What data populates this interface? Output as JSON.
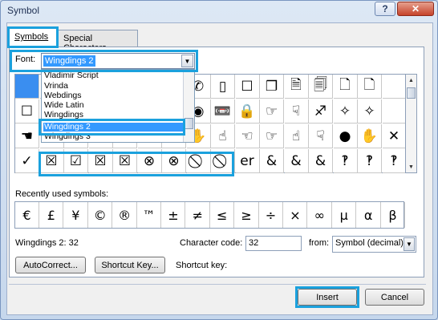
{
  "window": {
    "title": "Symbol",
    "help": "?",
    "close": "✕"
  },
  "tabs": [
    {
      "label": "Symbols",
      "active": true
    },
    {
      "label": "Special Characters",
      "active": false
    }
  ],
  "font": {
    "label": "Font:",
    "value": "Wingdings 2"
  },
  "font_dropdown": {
    "options": [
      "Vladimir Script",
      "Vrinda",
      "Webdings",
      "Wide Latin",
      "Wingdings",
      "Wingdings 2",
      "Wingdings 3"
    ],
    "selected": "Wingdings 2"
  },
  "grid": {
    "rows": [
      [
        "",
        "",
        "",
        "",
        "",
        "",
        "",
        "✆",
        "▯",
        "☐",
        "❐",
        "🗎",
        "🗐",
        "🗋",
        "🗋",
        ""
      ],
      [
        "☐",
        "",
        "",
        "",
        "",
        "",
        "",
        "◉",
        "📼",
        "🔒",
        "☞",
        "☟",
        "♐",
        "✧",
        "✧",
        ""
      ],
      [
        "☚",
        "",
        "",
        "",
        "",
        "",
        "",
        "✋",
        "☝",
        "☜",
        "☞",
        "☝",
        "☟",
        "●",
        "✋",
        "✕"
      ],
      [
        "✓",
        "☒",
        "☑",
        "☒",
        "☒",
        "⊗",
        "⊗",
        "⃠",
        "⃠",
        "er",
        "&",
        "&",
        "&",
        "‽",
        "‽",
        "‽"
      ]
    ],
    "highlight_note": ""
  },
  "recent": {
    "label": "Recently used symbols:",
    "symbols": [
      "€",
      "£",
      "¥",
      "©",
      "®",
      "™",
      "±",
      "≠",
      "≤",
      "≥",
      "÷",
      "×",
      "∞",
      "µ",
      "α",
      "β"
    ]
  },
  "char_info": {
    "name": "Wingdings 2: 32",
    "code_label": "Character code:",
    "code_value": "32",
    "from_label": "from:",
    "from_value": "Symbol (decimal)",
    "shortcut_key_label": "Shortcut key:"
  },
  "buttons": {
    "autocorrect": "AutoCorrect...",
    "shortcut_key": "Shortcut Key...",
    "insert": "Insert",
    "cancel": "Cancel"
  },
  "colors": {
    "highlight": "#1ba1dd",
    "selection": "#3399ff"
  }
}
